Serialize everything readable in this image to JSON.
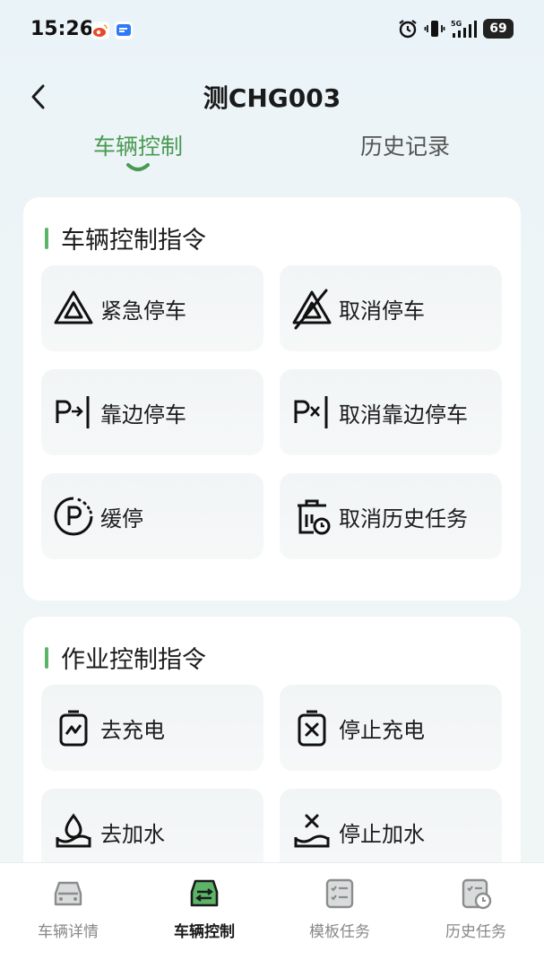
{
  "status_bar": {
    "time": "15:26",
    "battery": "69",
    "network": "5G"
  },
  "header": {
    "title": "测CHG003"
  },
  "tabs": [
    {
      "label": "车辆控制",
      "active": true
    },
    {
      "label": "历史记录",
      "active": false
    }
  ],
  "sections": [
    {
      "title": "车辆控制指令",
      "commands": [
        {
          "label": "紧急停车",
          "icon": "warning-triangle-icon"
        },
        {
          "label": "取消停车",
          "icon": "cancel-triangle-icon"
        },
        {
          "label": "靠边停车",
          "icon": "pull-over-icon"
        },
        {
          "label": "取消靠边停车",
          "icon": "cancel-pull-over-icon"
        },
        {
          "label": "缓停",
          "icon": "slow-stop-icon"
        },
        {
          "label": "取消历史任务",
          "icon": "cancel-history-task-icon"
        }
      ]
    },
    {
      "title": "作业控制指令",
      "commands": [
        {
          "label": "去充电",
          "icon": "charge-icon"
        },
        {
          "label": "停止充电",
          "icon": "stop-charge-icon"
        },
        {
          "label": "去加水",
          "icon": "water-icon"
        },
        {
          "label": "停止加水",
          "icon": "stop-water-icon"
        }
      ]
    }
  ],
  "bottom_nav": [
    {
      "label": "车辆详情",
      "icon": "car-icon",
      "active": false
    },
    {
      "label": "车辆控制",
      "icon": "car-control-icon",
      "active": true
    },
    {
      "label": "模板任务",
      "icon": "template-list-icon",
      "active": false
    },
    {
      "label": "历史任务",
      "icon": "history-task-icon",
      "active": false
    }
  ],
  "colors": {
    "accent": "#4a9a52",
    "section_bar": "#5bb468",
    "background": "#eef5f7"
  }
}
